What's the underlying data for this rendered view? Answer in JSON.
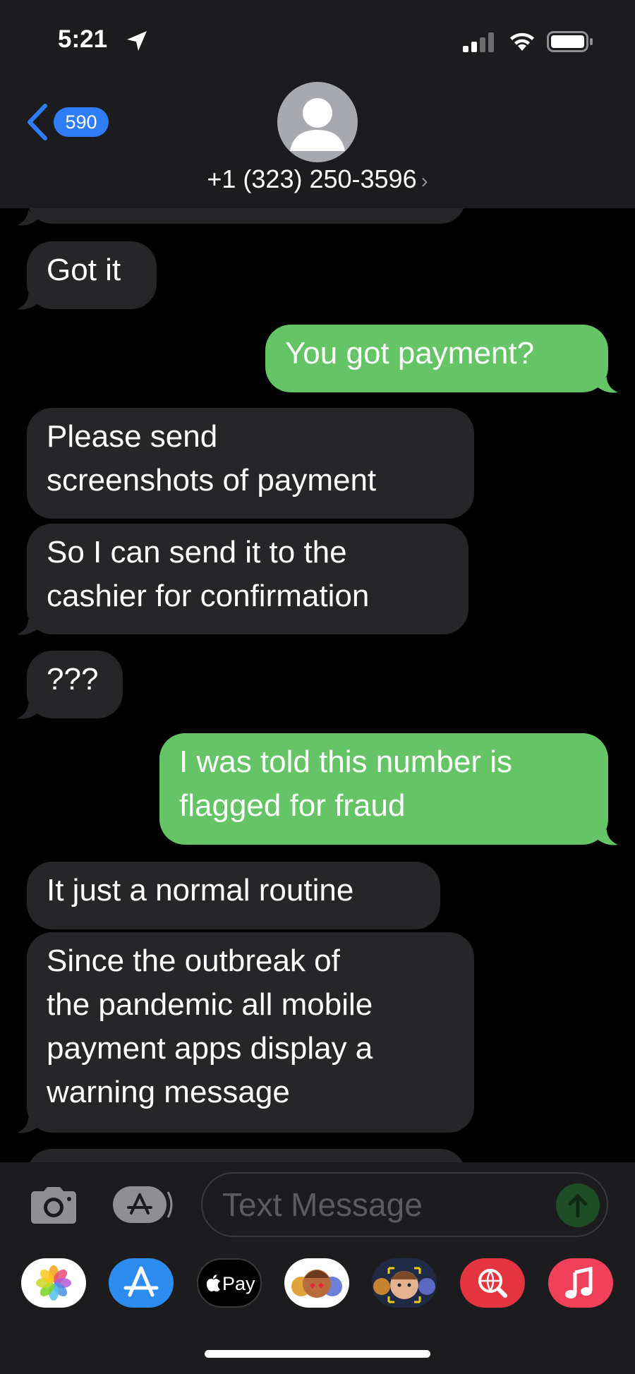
{
  "status_bar": {
    "time": "5:21"
  },
  "header": {
    "back_count": "590",
    "contact": "+1 (323) 250-3596",
    "chevron": "›"
  },
  "messages": [
    {
      "from": "them",
      "text": [
        "Got it"
      ]
    },
    {
      "from": "me",
      "text": [
        "You got payment?"
      ]
    },
    {
      "from": "them",
      "text": [
        "Please send",
        "screenshots of payment"
      ]
    },
    {
      "from": "them",
      "text": [
        "So I can send it to the",
        "cashier for confirmation"
      ]
    },
    {
      "from": "them",
      "text": [
        "???"
      ]
    },
    {
      "from": "me",
      "text": [
        "I was told this number is",
        "flagged for fraud"
      ]
    },
    {
      "from": "them",
      "text": [
        "It just a normal routine"
      ]
    },
    {
      "from": "them",
      "text": [
        "Since the outbreak of",
        "the pandemic all mobile",
        "payment apps display a",
        "warning message"
      ]
    }
  ],
  "input": {
    "placeholder": "Text Message"
  },
  "apps": [
    "photos-app",
    "app-store-app",
    "apple-pay-app",
    "memoji-stickers-app",
    "animoji-app",
    "web-images-app",
    "music-app"
  ],
  "apple_pay_label": "Pay",
  "colors": {
    "incoming_bubble": "#262628",
    "outgoing_bubble": "#65c466",
    "header_bg": "#1c1c1e",
    "badge": "#2f7df6"
  }
}
